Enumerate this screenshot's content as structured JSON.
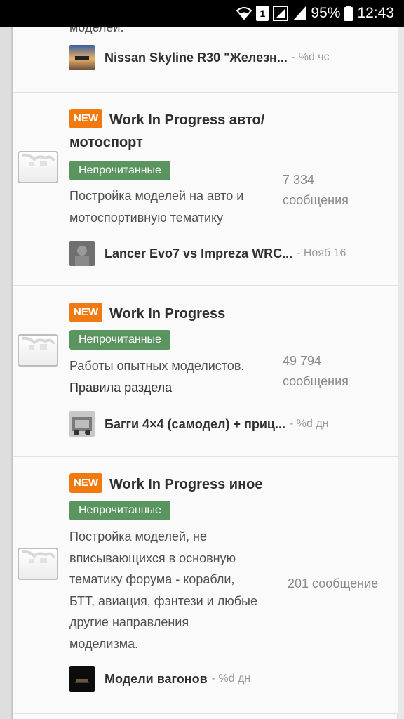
{
  "status_bar": {
    "battery_percent": "95%",
    "time": "12:43",
    "sim_label": "1"
  },
  "top_node": {
    "partial_desc": "моделей.",
    "last_post": {
      "title": "Nissan Skyline R30 \"Железн...",
      "time": "- %d чс"
    }
  },
  "nodes": [
    {
      "badge_new": "NEW",
      "title_line1": "Work In Progress авто/",
      "title_line2": "мотоспорт",
      "unread": "Непрочитанные",
      "desc_lines": [
        "Постройка моделей на авто и",
        "мотоспортивную тематику"
      ],
      "count_value": "7 334",
      "count_unit": "сообщения",
      "last_post": {
        "title": "Lancer Evo7 vs Impreza WRC...",
        "time": "- Нояб 16"
      }
    },
    {
      "badge_new": "NEW",
      "title_line1": "Work In Progress",
      "unread": "Непрочитанные",
      "desc_lines": [
        "Работы опытных моделистов."
      ],
      "rules_link": "Правила раздела",
      "count_value": "49 794",
      "count_unit": "сообщения",
      "last_post": {
        "title": "Багги 4×4 (самодел) + приц...",
        "time": "- %d дн"
      }
    },
    {
      "badge_new": "NEW",
      "title_line1": "Work In Progress иное",
      "unread": "Непрочитанные",
      "desc_lines": [
        "Постройка моделей, не",
        "вписывающихся в основную",
        "тематику форума - корабли,",
        "БТТ, авиация, фэнтези и любые",
        "другие направления",
        "моделизма."
      ],
      "count_value": "201 сообщение",
      "last_post": {
        "title": "Модели вагонов",
        "time": "- %d дн"
      }
    }
  ],
  "colors": {
    "new_badge": "#f07a10",
    "unread_badge": "#5a9560",
    "background": "#fafafa"
  }
}
